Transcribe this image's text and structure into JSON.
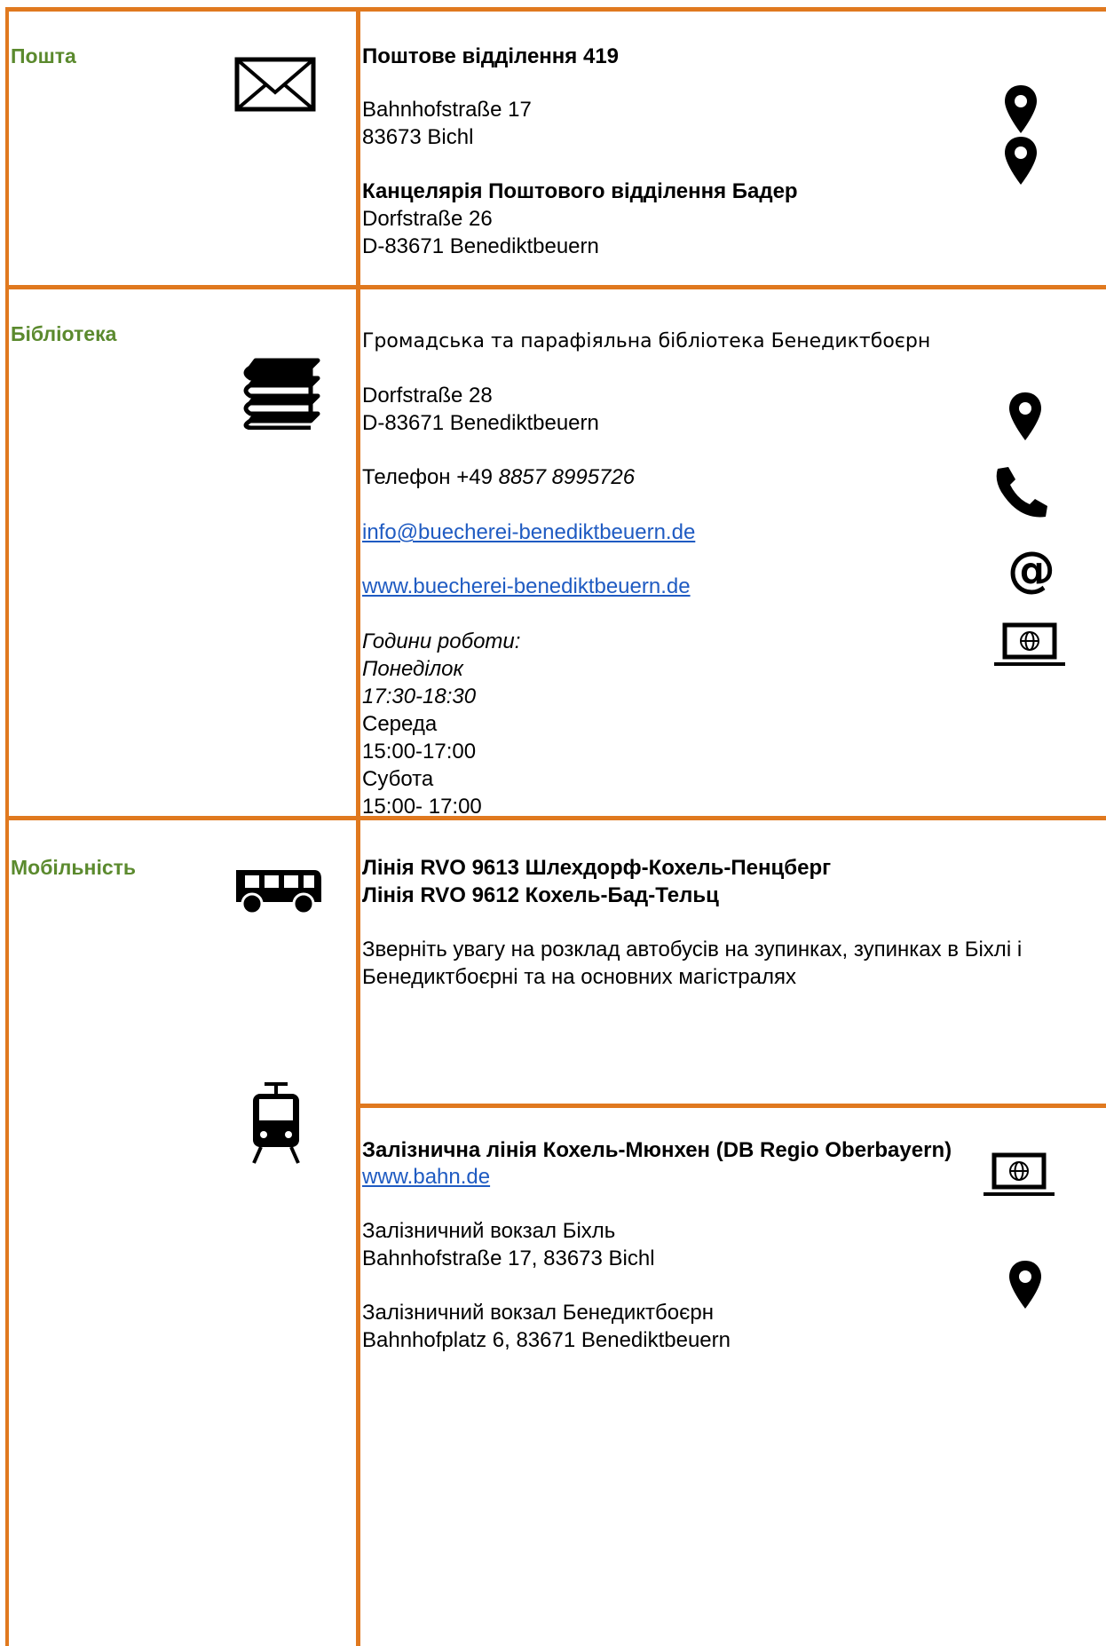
{
  "post": {
    "category": "Пошта",
    "office_title": "Поштове відділення 419",
    "office_street": "Bahnhofstraße 17",
    "office_city": "83673 Bichl",
    "agency_title": "Канцелярія Поштового відділення Бадер",
    "agency_street": "Dorfstraße 26",
    "agency_city": "D-83671 Benediktbeuern"
  },
  "library": {
    "category": "Бібліотека",
    "name": "Громадська та парафіяльна бібліотека Бенедиктбоєрн",
    "street": "Dorfstraße 28",
    "city": "D-83671 Benediktbeuern",
    "phone_prefix": "Телефон +49 ",
    "phone_number": "8857 8995726",
    "email": "info@buecherei-benediktbeuern.de",
    "website": "www.buecherei-benediktbeuern.de",
    "hours_label": "Години роботи:",
    "hours": [
      {
        "day": "Понеділок",
        "time": "17:30-18:30"
      },
      {
        "day": "Середа",
        "time": "15:00-17:00"
      },
      {
        "day": "Субота",
        "time": "15:00- 17:00"
      }
    ]
  },
  "mobility": {
    "category": "Мобільність",
    "bus_line_1": "Лінія RVO 9613 Шлехдорф-Кохель-Пенцберг",
    "bus_line_2": "Лінія RVO 9612 Кохель-Бад-Тельц",
    "bus_note_1": "Зверніть увагу на розклад автобусів на зупинках, зупинках в Біхлі і",
    "bus_note_2": "Бенедиктбоєрні та на основних магістралях",
    "rail_title": "Залізнична лінія Кохель-Мюнхен (DB Regio Oberbayern)",
    "rail_website": "www.bahn.de",
    "station1_name": "Залізничний вокзал Біхль",
    "station1_address": "Bahnhofstraße 17, 83673 Bichl",
    "station2_name": "Залізничний вокзал Бенедиктбоєрн",
    "station2_address": "Bahnhofplatz 6, 83671 Benediktbeuern"
  },
  "colors": {
    "border": "#E0791F",
    "category": "#5B8A2E",
    "link": "#1F5BC2"
  },
  "icons": [
    "envelope-icon",
    "map-pin-icon",
    "books-icon",
    "phone-icon",
    "at-sign-icon",
    "laptop-globe-icon",
    "bus-icon",
    "tram-icon"
  ]
}
